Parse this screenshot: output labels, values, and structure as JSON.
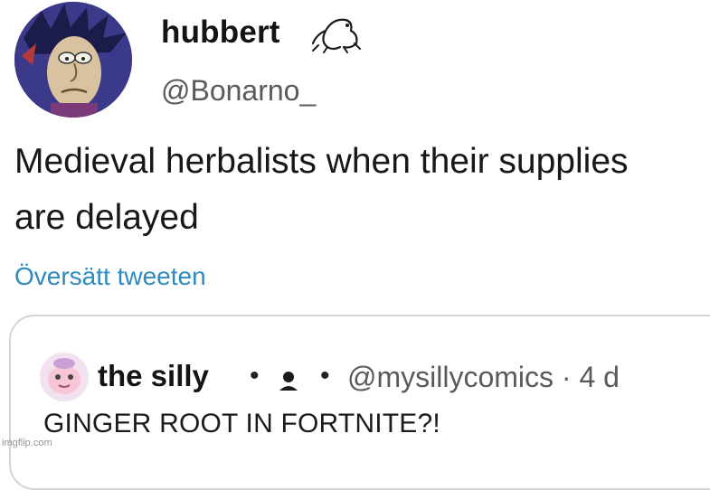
{
  "author": {
    "display_name": "hubbert",
    "handle": "@Bonarno_",
    "avatar_icon": "cartoon-character-avatar",
    "badge_icon": "frog-icon"
  },
  "tweet": {
    "text": "Medieval herbalists when their supplies are delayed",
    "translate_label": "Översätt tweeten"
  },
  "quoted_tweet": {
    "display_name": "the silly",
    "separator": "•",
    "badge_icon": "person-icon",
    "handle_and_time": "@mysillycomics · 4 d",
    "text": "GINGER ROOT IN FORTNITE?!",
    "avatar_icon": "pink-cartoon-avatar"
  },
  "watermark": "imgflip.com",
  "colors": {
    "link": "#2e8bbf",
    "handle": "#5a5a5a",
    "card_border": "#d4d4d4",
    "avatar_bg": "#3c3a86"
  }
}
